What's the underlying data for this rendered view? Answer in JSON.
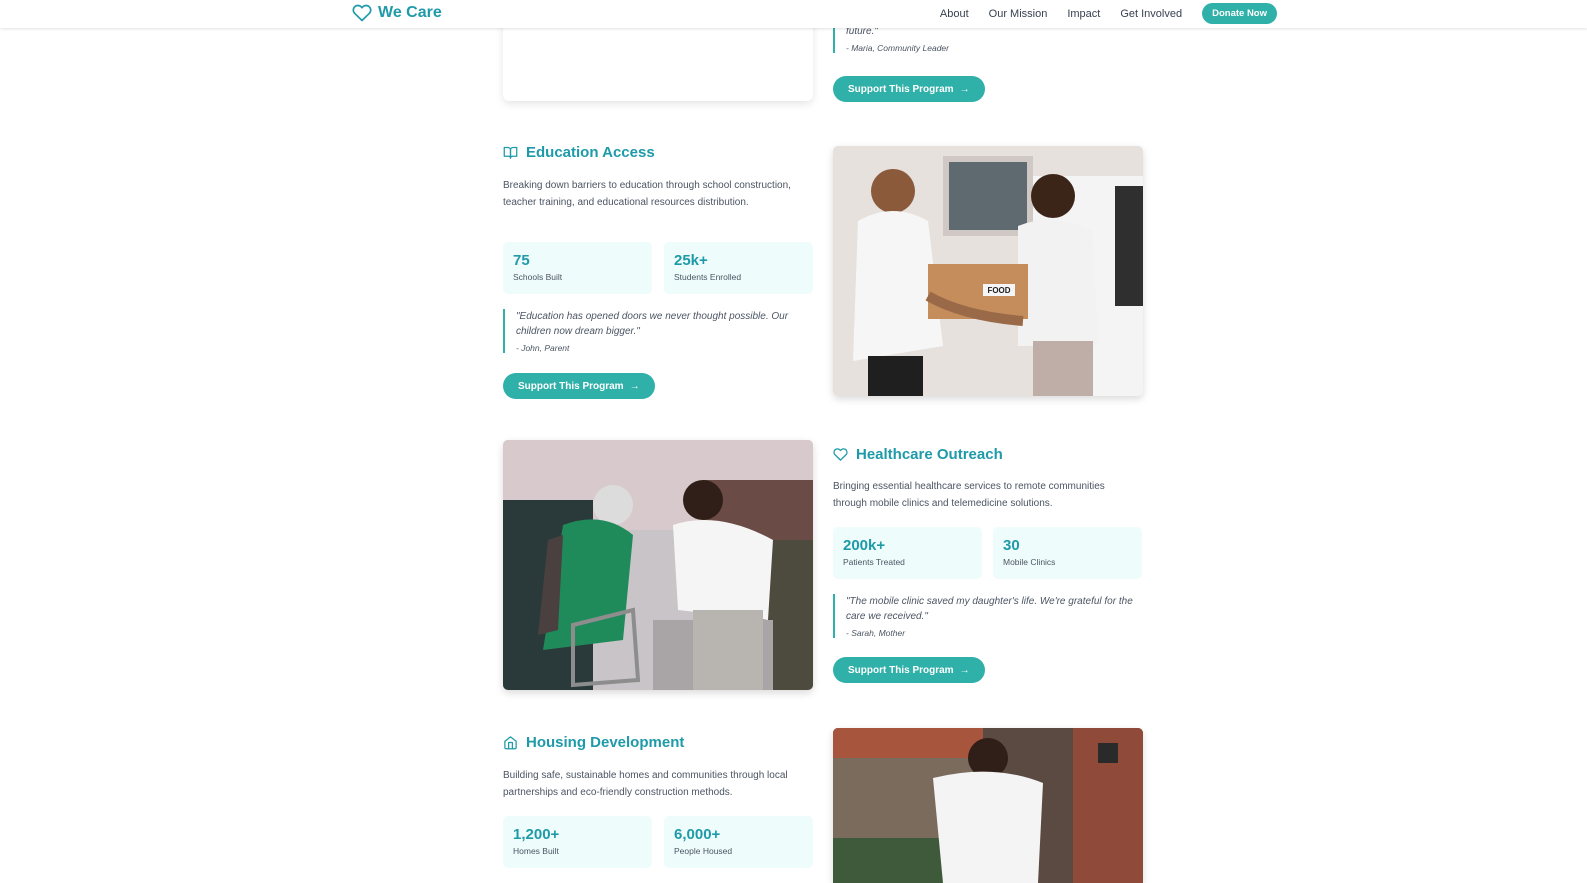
{
  "nav": {
    "brand": "We Care",
    "links": [
      "About",
      "Our Mission",
      "Impact",
      "Get Involved"
    ],
    "donate": "Donate Now"
  },
  "top_section": {
    "quote_text": "future.\"",
    "quote_author": "- Maria, Community Leader",
    "button": "Support This Program"
  },
  "programs": [
    {
      "icon": "book-icon",
      "title": "Education Access",
      "description": "Breaking down barriers to education through school construction, teacher training, and educational resources distribution.",
      "stats": [
        {
          "value": "75",
          "label": "Schools Built"
        },
        {
          "value": "25k+",
          "label": "Students Enrolled"
        }
      ],
      "quote": "\"Education has opened doors we never thought possible. Our children now dream bigger.\"",
      "author": "- John, Parent",
      "button": "Support This Program",
      "photo_text": "FOOD"
    },
    {
      "icon": "heart-icon",
      "title": "Healthcare Outreach",
      "description": "Bringing essential healthcare services to remote communities through mobile clinics and telemedicine solutions.",
      "stats": [
        {
          "value": "200k+",
          "label": "Patients Treated"
        },
        {
          "value": "30",
          "label": "Mobile Clinics"
        }
      ],
      "quote": "\"The mobile clinic saved my daughter's life. We're grateful for the care we received.\"",
      "author": "- Sarah, Mother",
      "button": "Support This Program"
    },
    {
      "icon": "home-icon",
      "title": "Housing Development",
      "description": "Building safe, sustainable homes and communities through local partnerships and eco-friendly construction methods.",
      "stats": [
        {
          "value": "1,200+",
          "label": "Homes Built"
        },
        {
          "value": "6,000+",
          "label": "People Housed"
        }
      ]
    }
  ],
  "colors": {
    "accent": "#1e9aa9",
    "button": "#2fb0a8",
    "stat_bg": "#effcfc"
  }
}
